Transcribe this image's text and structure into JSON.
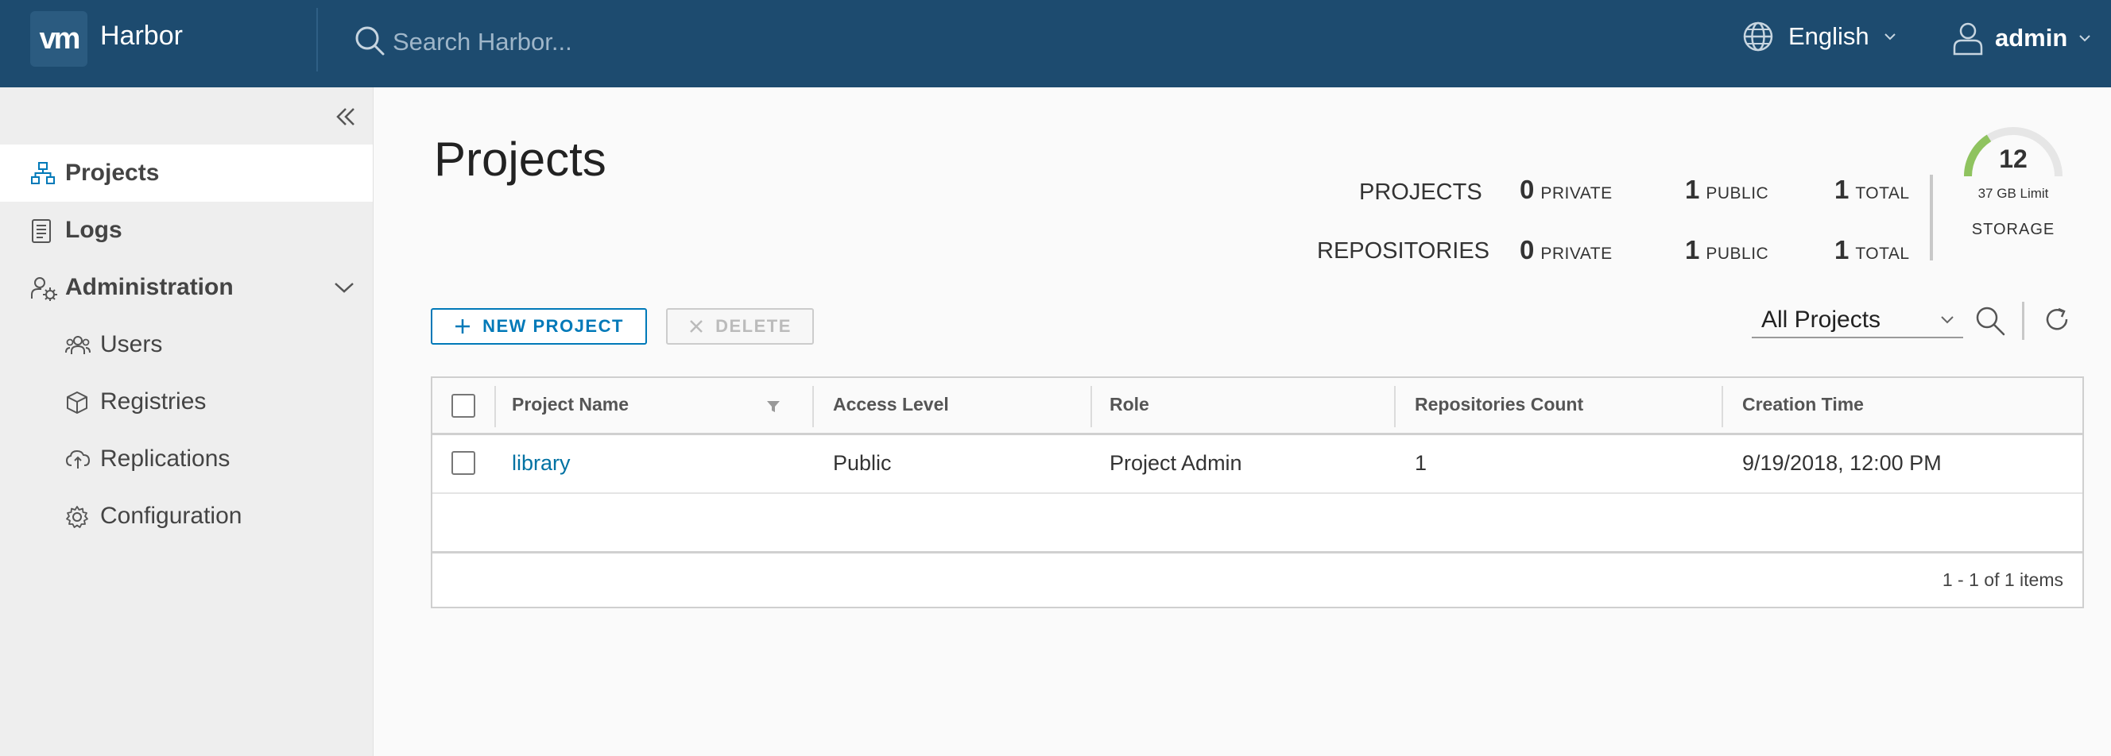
{
  "header": {
    "logo_text": "vm",
    "app_title": "Harbor",
    "search_placeholder": "Search Harbor...",
    "language": "English",
    "user": "admin",
    "background": "#1d4b6f"
  },
  "sidebar": {
    "items": [
      {
        "label": "Projects",
        "icon": "projects-icon",
        "active": true
      },
      {
        "label": "Logs",
        "icon": "logs-icon"
      },
      {
        "label": "Administration",
        "icon": "administration-icon",
        "expanded": true
      },
      {
        "label": "Users",
        "icon": "users-icon"
      },
      {
        "label": "Registries",
        "icon": "registries-icon"
      },
      {
        "label": "Replications",
        "icon": "replications-icon"
      },
      {
        "label": "Configuration",
        "icon": "configuration-icon"
      }
    ]
  },
  "main": {
    "title": "Projects",
    "stats": {
      "projects_label": "PROJECTS",
      "repositories_label": "REPOSITORIES",
      "private_label": "PRIVATE",
      "public_label": "PUBLIC",
      "total_label": "TOTAL",
      "projects": {
        "private": "0",
        "public": "1",
        "total": "1"
      },
      "repositories": {
        "private": "0",
        "public": "1",
        "total": "1"
      }
    },
    "storage": {
      "value": "12",
      "limit": "37  GB  Limit",
      "label": "STORAGE",
      "fill_fraction": 0.32,
      "gauge_color": "#8fc35f"
    },
    "toolbar": {
      "new_project": "NEW PROJECT",
      "delete": "DELETE",
      "filter_selected": "All Projects",
      "accent": "#0079b8"
    },
    "table": {
      "columns": [
        "Project Name",
        "Access Level",
        "Role",
        "Repositories Count",
        "Creation Time"
      ],
      "rows": [
        {
          "name": "library",
          "access": "Public",
          "role": "Project Admin",
          "repos": "1",
          "created": "9/19/2018, 12:00 PM"
        }
      ],
      "footer": "1 - 1 of 1 items"
    }
  }
}
